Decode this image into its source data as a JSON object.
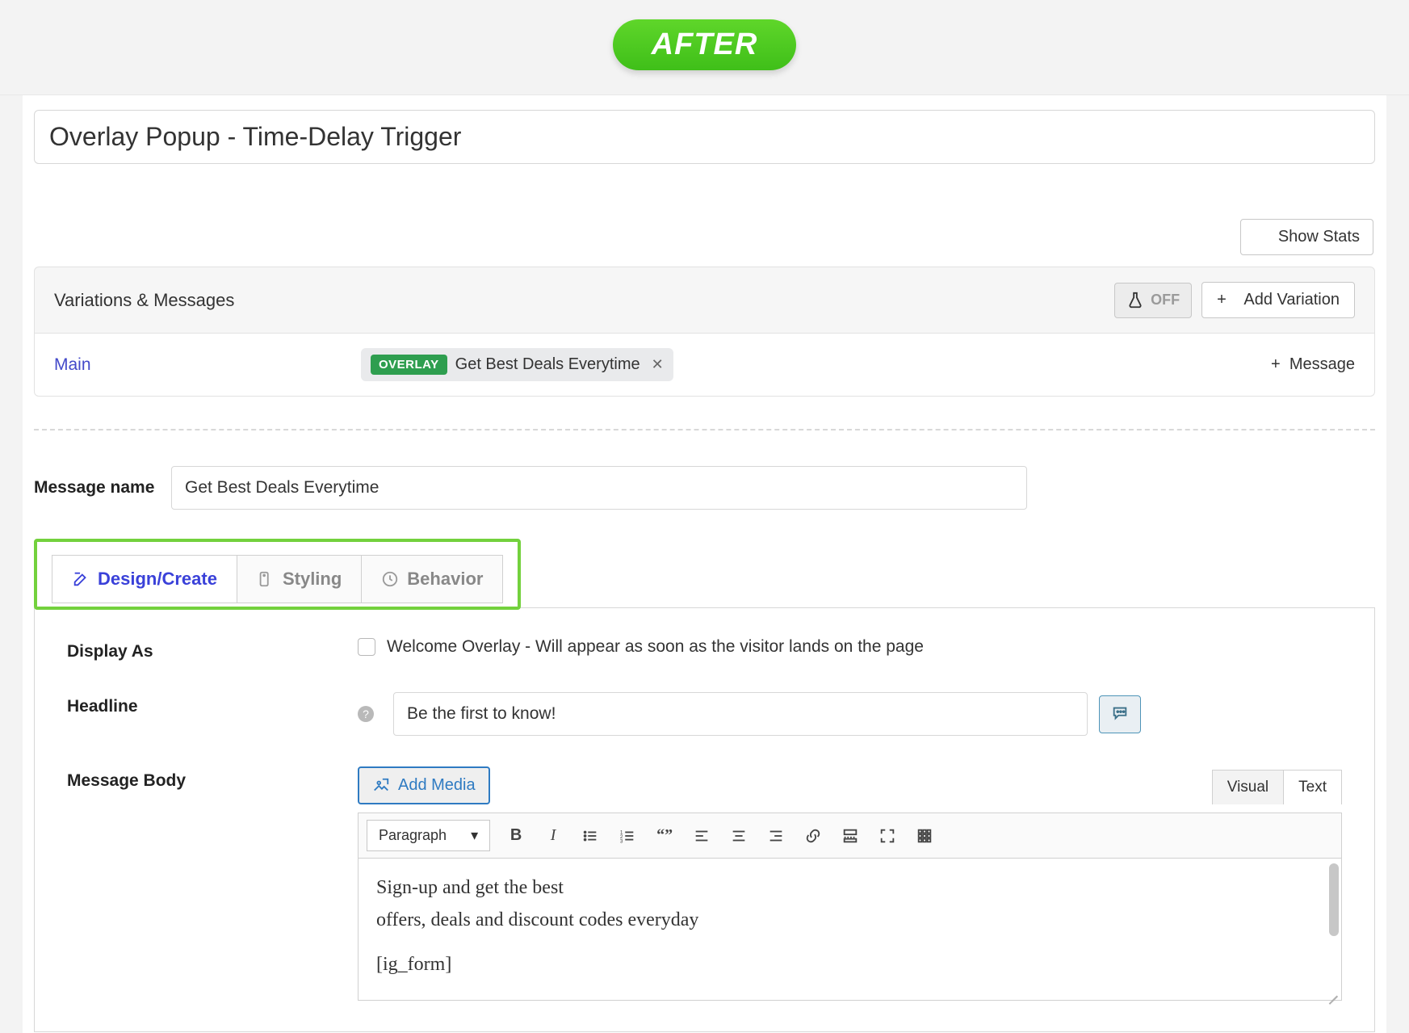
{
  "badge": "AFTER",
  "title": "Overlay Popup - Time-Delay Trigger",
  "show_stats": "Show Stats",
  "variations_header": "Variations & Messages",
  "toggle": "OFF",
  "add_variation": "Add Variation",
  "variation_name": "Main",
  "chip_tag": "OVERLAY",
  "chip_label": "Get Best Deals Everytime",
  "add_message": "Message",
  "message_name_label": "Message name",
  "message_name_value": "Get Best Deals Everytime",
  "tabs": {
    "design": "Design/Create",
    "styling": "Styling",
    "behavior": "Behavior"
  },
  "display_as_label": "Display As",
  "welcome_overlay_text": "Welcome Overlay - Will appear as soon as the visitor lands on the page",
  "headline_label": "Headline",
  "headline_value": "Be the first to know!",
  "message_body_label": "Message Body",
  "add_media": "Add Media",
  "editor_tabs": {
    "visual": "Visual",
    "text": "Text"
  },
  "format_select": "Paragraph",
  "body_line1": "Sign-up and get the best",
  "body_line2": "offers, deals and discount codes everyday",
  "body_line3": "[ig_form]",
  "colors": {
    "accent": "#3a41d9",
    "green": "#73d13d",
    "tag": "#2e9e4f"
  }
}
